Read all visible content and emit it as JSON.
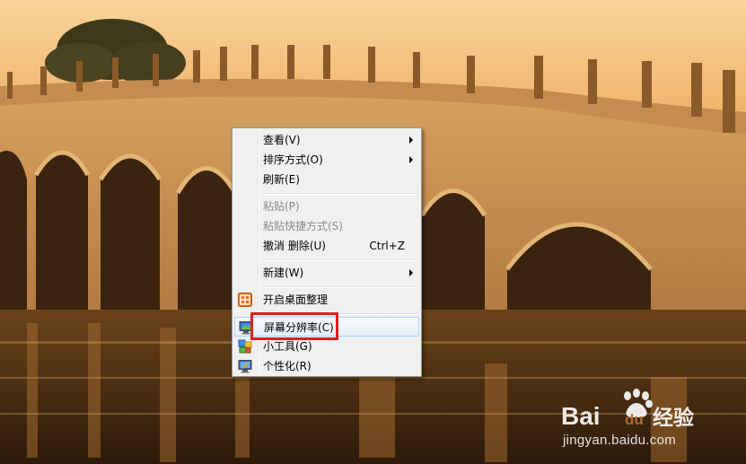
{
  "context_menu": {
    "items": [
      {
        "label": "查看(V)",
        "submenu": true,
        "disabled": false
      },
      {
        "label": "排序方式(O)",
        "submenu": true,
        "disabled": false
      },
      {
        "label": "刷新(E)",
        "submenu": false,
        "disabled": false
      },
      {
        "label": "粘贴(P)",
        "submenu": false,
        "disabled": true
      },
      {
        "label": "粘贴快捷方式(S)",
        "submenu": false,
        "disabled": true
      },
      {
        "label": "撤消 删除(U)",
        "shortcut": "Ctrl+Z",
        "submenu": false,
        "disabled": false
      },
      {
        "label": "新建(W)",
        "submenu": true,
        "disabled": false
      },
      {
        "label": "开启桌面整理",
        "icon": "desktop-organizer-icon",
        "submenu": false,
        "disabled": false
      },
      {
        "label": "屏幕分辨率(C)",
        "icon": "monitor-icon",
        "submenu": false,
        "disabled": false,
        "highlighted": true
      },
      {
        "label": "小工具(G)",
        "icon": "gadgets-icon",
        "submenu": false,
        "disabled": false
      },
      {
        "label": "个性化(R)",
        "icon": "personalize-icon",
        "submenu": false,
        "disabled": false
      }
    ]
  },
  "annotation": {
    "color": "#e01e1e"
  },
  "watermark": {
    "logo_text": "Bai",
    "logo_text_2": "du",
    "brand_cn": "经验",
    "url": "jingyan.baidu.com"
  }
}
